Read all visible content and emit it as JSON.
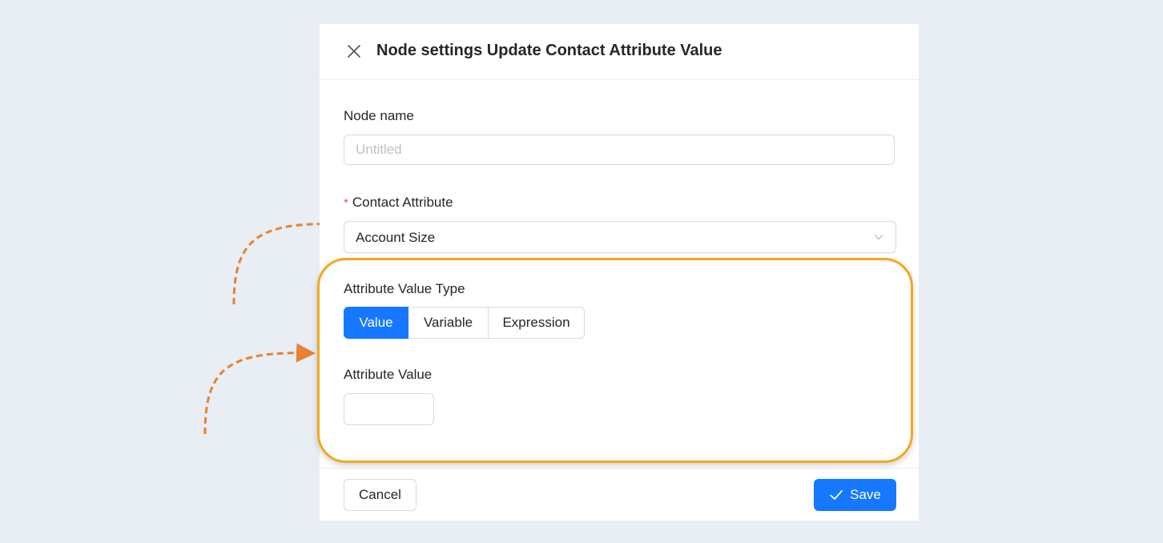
{
  "colors": {
    "background": "#e9edf4",
    "primary": "#1677ff",
    "highlight": "#f2a81d",
    "annotation_arrow": "#e8822f",
    "required": "#ff4d4f"
  },
  "header": {
    "close_icon": "close-icon",
    "title": "Node settings Update Contact Attribute Value"
  },
  "form": {
    "node_name": {
      "label": "Node name",
      "placeholder": "Untitled",
      "value": ""
    },
    "contact_attribute": {
      "required_mark": "*",
      "label": "Contact Attribute",
      "selected": "Account Size",
      "arrow_icon": "chevron-down-icon"
    },
    "attribute_value_type": {
      "label": "Attribute Value Type",
      "options": [
        "Value",
        "Variable",
        "Expression"
      ],
      "selected": "Value"
    },
    "attribute_value": {
      "label": "Attribute Value",
      "value": ""
    }
  },
  "footer": {
    "cancel_label": "Cancel",
    "save_label": "Save",
    "save_icon": "check-icon"
  }
}
